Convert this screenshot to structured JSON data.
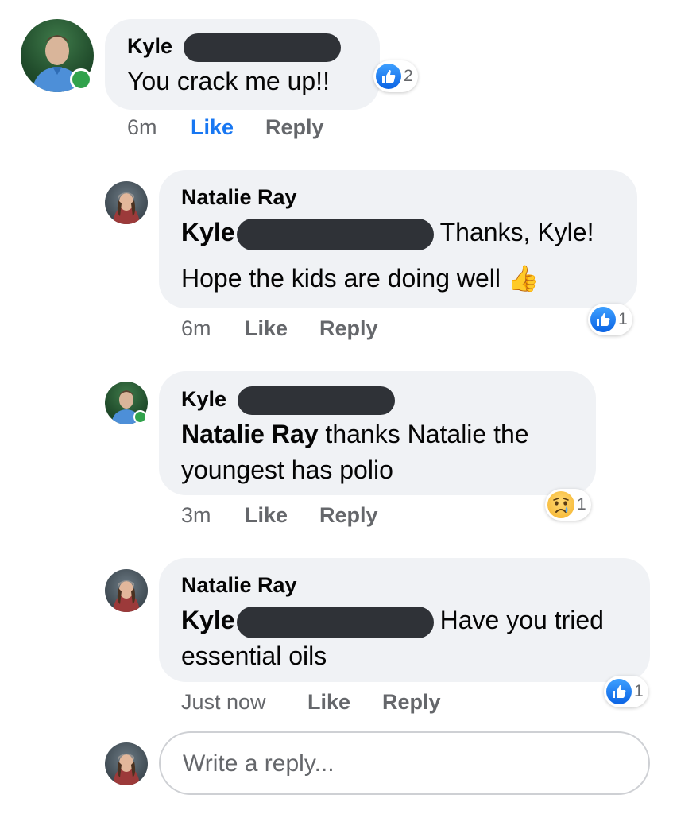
{
  "comments": [
    {
      "author": "Kyle",
      "text_lines": [
        "You crack me up!!"
      ],
      "time": "6m",
      "like": "Like",
      "reply": "Reply",
      "reaction": {
        "icon": "like-icon",
        "count": "2"
      }
    },
    {
      "author": "Natalie Ray",
      "mention": "Kyle",
      "text_lines": [
        "Thanks, Kyle!",
        "Hope the kids are doing well"
      ],
      "emoji": "👍",
      "time": "6m",
      "like": "Like",
      "reply": "Reply",
      "reaction": {
        "icon": "like-icon",
        "count": "1"
      }
    },
    {
      "author": "Kyle",
      "mention": "Natalie Ray",
      "text_lines": [
        " thanks Natalie the",
        "youngest has polio"
      ],
      "time": "3m",
      "like": "Like",
      "reply": "Reply",
      "reaction": {
        "icon": "sad-face-icon",
        "count": "1"
      }
    },
    {
      "author": "Natalie Ray",
      "mention": "Kyle",
      "text_lines": [
        "Have you tried",
        "essential oils"
      ],
      "time": "Just now",
      "like": "Like",
      "reply": "Reply",
      "reaction": {
        "icon": "like-icon",
        "count": "1"
      }
    }
  ],
  "reply_input": {
    "placeholder": "Write a reply..."
  },
  "colors": {
    "accent": "#1877f2",
    "bubble": "#f0f2f5",
    "meta": "#65676b",
    "online": "#31a24c"
  }
}
